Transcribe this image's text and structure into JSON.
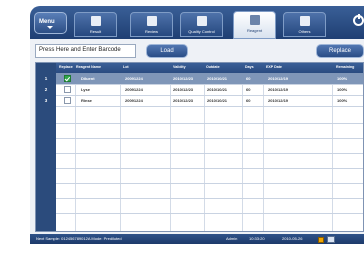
{
  "menu": {
    "label": "Menu"
  },
  "tabs": [
    {
      "label": "Result",
      "icon": "result-icon",
      "active": false
    },
    {
      "label": "Review",
      "icon": "review-icon",
      "active": false
    },
    {
      "label": "Quality Control",
      "icon": "quality-control-icon",
      "active": false
    },
    {
      "label": "Reagent",
      "icon": "reagent-icon",
      "active": true
    },
    {
      "label": "Others",
      "icon": "others-icon",
      "active": false
    }
  ],
  "toolbar": {
    "barcode_value": "Press Here and Enter Barcode",
    "load_label": "Load",
    "replace_label": "Replace"
  },
  "table": {
    "columns": [
      "Replace",
      "Reagent Name",
      "Lot",
      "Validity",
      "Outdate",
      "Days",
      "EXP Date",
      "Remaining"
    ],
    "rows": [
      {
        "num": "1",
        "checked": true,
        "name": "Diluent",
        "lot": "20091224",
        "validity": "2010/12/23",
        "outdate": "2010/10/21",
        "days": "60",
        "exp": "2010/12/19",
        "remaining": "100%"
      },
      {
        "num": "2",
        "checked": false,
        "name": "Lyse",
        "lot": "20091224",
        "validity": "2010/12/23",
        "outdate": "2010/10/21",
        "days": "60",
        "exp": "2010/12/19",
        "remaining": "100%"
      },
      {
        "num": "3",
        "checked": false,
        "name": "Rinse",
        "lot": "20091224",
        "validity": "2010/12/23",
        "outdate": "2010/10/21",
        "days": "60",
        "exp": "2010/12/19",
        "remaining": "100%"
      }
    ]
  },
  "status": {
    "next_sample": "Next Sample: 012456789012A  Mode: Prediluted",
    "user": "Admin",
    "time": "10:33:20",
    "date": "2010-05-26"
  },
  "colors": {
    "header": "#2a4b80",
    "selected_row": "#7f96b8",
    "check": "#2fa84a"
  }
}
